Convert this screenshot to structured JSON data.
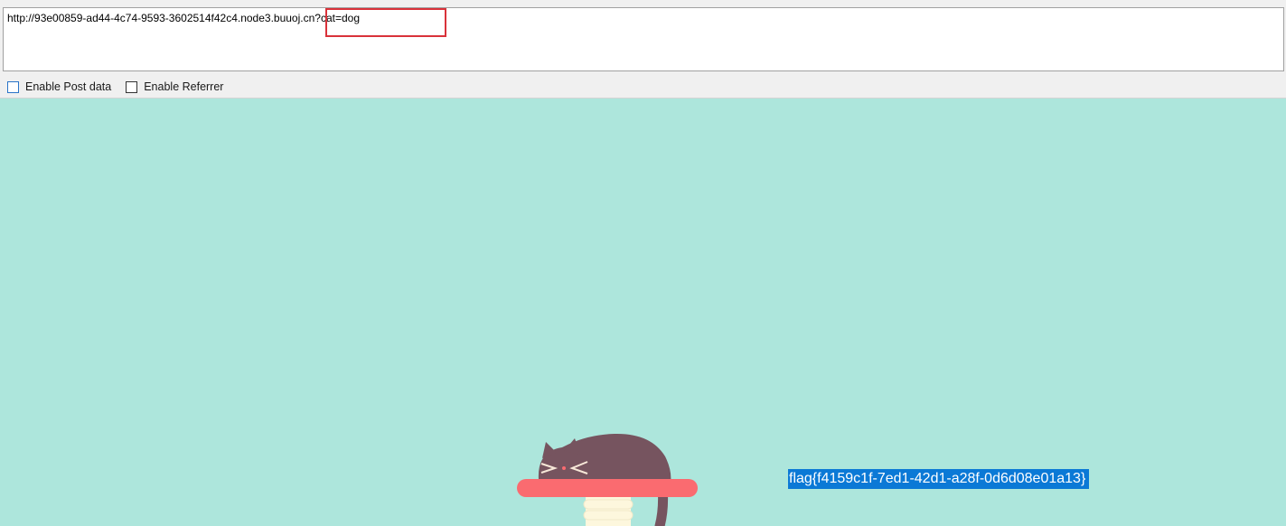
{
  "toolbar": {
    "url_value": "http://93e00859-ad44-4c74-9593-3602514f42c4.node3.buuoj.cn?cat=dog",
    "options": [
      {
        "label": "Enable Post data",
        "checked": false
      },
      {
        "label": "Enable Referrer",
        "checked": false
      }
    ]
  },
  "page": {
    "flag_text": "flag{f4159c1f-7ed1-42d1-a28f-0d6d08e01a13}",
    "background_color": "#ade6dc",
    "selection_color": "#0b79d6"
  },
  "colors": {
    "annotation_border": "#d9323a",
    "cat_body": "#76545f",
    "shelf": "#fa6b70",
    "post": "#fdf7dd"
  }
}
